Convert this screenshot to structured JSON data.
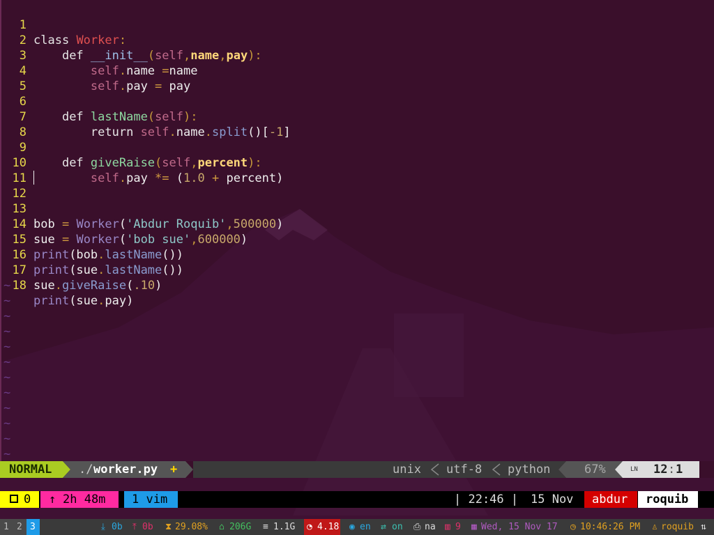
{
  "editor": {
    "lines": [
      {
        "n": "1",
        "t": "class Worker:"
      },
      {
        "n": "2",
        "t": "def __init__(self,name,pay):"
      },
      {
        "n": "3",
        "t": "self.name =name"
      },
      {
        "n": "4",
        "t": "self.pay = pay"
      },
      {
        "n": "5",
        "t": ""
      },
      {
        "n": "6",
        "t": "def lastName(self):"
      },
      {
        "n": "7",
        "t": "return self.name.split()[-1]"
      },
      {
        "n": "8",
        "t": ""
      },
      {
        "n": "9",
        "t": "def giveRaise(self,percent):"
      },
      {
        "n": "10",
        "t": "self.pay *= (1.0 + percent)"
      },
      {
        "n": "11",
        "t": ""
      },
      {
        "n": "12",
        "t": ""
      },
      {
        "n": "13",
        "t": "bob = Worker('Abdur Roquib',500000)"
      },
      {
        "n": "14",
        "t": "sue = Worker('bob sue',600000)"
      },
      {
        "n": "15",
        "t": "print(bob.lastName())"
      },
      {
        "n": "16",
        "t": "print(sue.lastName())"
      },
      {
        "n": "17",
        "t": "sue.giveRaise(.10)"
      },
      {
        "n": "18",
        "t": "print(sue.pay)"
      }
    ],
    "tilde": "~"
  },
  "statusline": {
    "mode": "NORMAL",
    "file_prefix": "./",
    "file_name": "worker.py",
    "modified": "+",
    "fileformat": "unix",
    "encoding": "utf-8",
    "filetype": "python",
    "percent": "67%",
    "ln_icon": "LN",
    "position_line": "12",
    "position_sep": ":",
    "position_col": "1"
  },
  "tmux": {
    "sessions": "0",
    "uptime": "2h 48m",
    "window": "1 vim",
    "time": "| 22:46 |",
    "date": "15 Nov",
    "user": "abdur",
    "host": "roquib"
  },
  "panel": {
    "workspaces": [
      "1",
      "2",
      "3"
    ],
    "active_workspace": "3",
    "download": "0b",
    "upload": "0b",
    "cpu": "29.08%",
    "disk": "206G",
    "memory": "1.1G",
    "load": "4.18",
    "language": "en",
    "network": "on",
    "printer": "na",
    "trash": "9",
    "date": "Wed, 15 Nov 17",
    "clock": "10:46:26 PM",
    "user": "roquib",
    "colors": {
      "mode_bg": "#aacc22",
      "tmux_yellow": "#ffff00",
      "tmux_magenta": "#ff2aa0",
      "tmux_blue": "#1e9be8",
      "user_red": "#d40000"
    }
  }
}
